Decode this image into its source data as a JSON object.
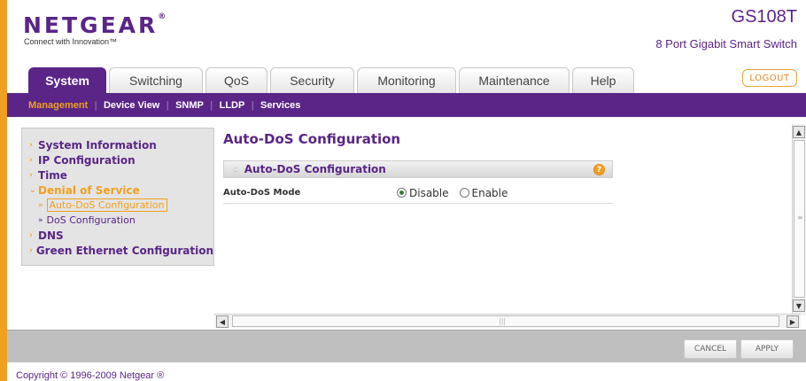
{
  "header": {
    "logo": "NETGEAR",
    "logo_reg": "®",
    "tagline": "Connect with Innovation™",
    "model": "GS108T",
    "product": "8 Port Gigabit Smart Switch",
    "logout": "LOGOUT"
  },
  "tabs": [
    {
      "label": "System"
    },
    {
      "label": "Switching"
    },
    {
      "label": "QoS"
    },
    {
      "label": "Security"
    },
    {
      "label": "Monitoring"
    },
    {
      "label": "Maintenance"
    },
    {
      "label": "Help"
    }
  ],
  "subnav": [
    {
      "label": "Management"
    },
    {
      "label": "Device View"
    },
    {
      "label": "SNMP"
    },
    {
      "label": "LLDP"
    },
    {
      "label": "Services"
    }
  ],
  "sidebar": {
    "items": [
      {
        "label": "System Information"
      },
      {
        "label": "IP Configuration"
      },
      {
        "label": "Time"
      },
      {
        "label": "Denial of Service"
      },
      {
        "label": "Auto-DoS Configuration"
      },
      {
        "label": "DoS Configuration"
      },
      {
        "label": "DNS"
      },
      {
        "label": "Green Ethernet Configuration"
      }
    ]
  },
  "content": {
    "page_title": "Auto-DoS Configuration",
    "panel_title": "Auto-DoS Configuration",
    "help": "?",
    "row_label": "Auto-DoS Mode",
    "options": [
      {
        "label": "Disable",
        "checked": true
      },
      {
        "label": "Enable",
        "checked": false
      }
    ]
  },
  "footer": {
    "cancel": "CANCEL",
    "apply": "APPLY",
    "copyright": "Copyright © 1996-2009 Netgear ®"
  },
  "colors": {
    "brand_purple": "#5a2587",
    "accent_orange": "#f0a020"
  }
}
